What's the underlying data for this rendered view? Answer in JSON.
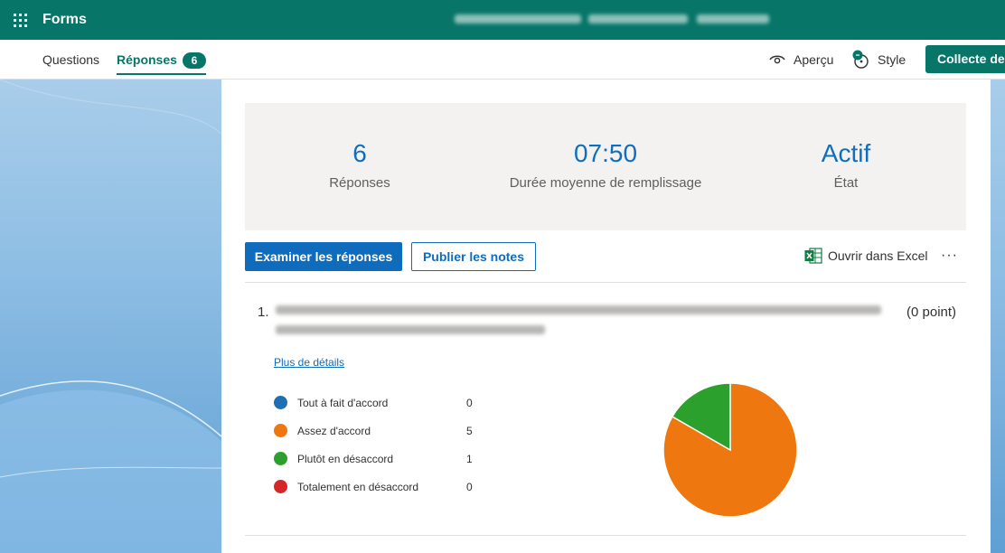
{
  "app": {
    "name": "Forms"
  },
  "tabs": [
    {
      "label": "Questions"
    },
    {
      "label": "Réponses",
      "badge": "6"
    }
  ],
  "toolbar": {
    "preview_label": "Aperçu",
    "style_label": "Style",
    "collect_label": "Collecte des"
  },
  "summary": {
    "responses": {
      "value": "6",
      "label": "Réponses"
    },
    "avg_time": {
      "value": "07:50",
      "label": "Durée moyenne de remplissage"
    },
    "status": {
      "value": "Actif",
      "label": "État"
    }
  },
  "actions": {
    "review_label": "Examiner les réponses",
    "publish_label": "Publier les notes",
    "excel_label": "Ouvrir dans Excel",
    "more_label": "···"
  },
  "question": {
    "number": "1.",
    "points": "(0 point)",
    "details_link": "Plus de détails"
  },
  "chart_data": {
    "type": "pie",
    "categories": [
      "Tout à fait d'accord",
      "Assez d'accord",
      "Plutôt en désaccord",
      "Totalement en désaccord"
    ],
    "values": [
      0,
      5,
      1,
      0
    ],
    "colors": [
      "#1f6fb4",
      "#ee7710",
      "#2ca02c",
      "#d62728"
    ],
    "legend_placement": "left"
  },
  "colors": {
    "brand": "#077568",
    "accent": "#0f6cbd"
  }
}
